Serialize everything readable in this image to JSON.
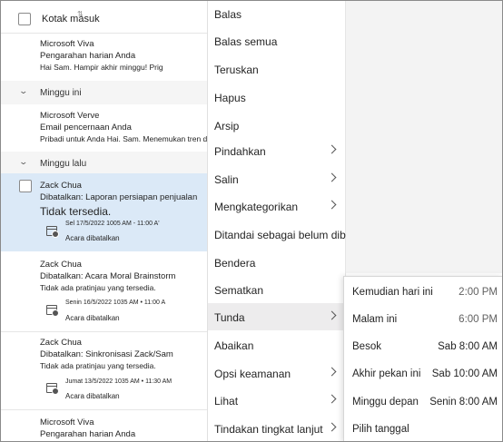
{
  "list_header": {
    "title": "Kotak masuk"
  },
  "groups": {
    "this_week": "Minggu ini",
    "last_week": "Minggu lalu"
  },
  "items": [
    {
      "sender": "Microsoft Viva",
      "subject": "Pengarahan harian Anda",
      "preview": "Hai Sam. Hampir akhir minggu! Prig"
    },
    {
      "sender": "Microsoft Verve",
      "subject": "Email pencernaan Anda",
      "preview": "Pribadi untuk Anda Hai. Sam. Menemukan tren di"
    },
    {
      "sender": "Zack Chua",
      "subject": "Dibatalkan: Laporan persiapan penjualan",
      "preview": "Tidak tersedia.",
      "meta": "Sel 17/5/2022 1005 AM - 11:00 A'",
      "status": "Acara dibatalkan"
    },
    {
      "sender": "Zack Chua",
      "subject": "Dibatalkan: Acara Moral Brainstorm",
      "preview": "Tidak ada pratinjau yang tersedia.",
      "meta": "Senin 16/5/2022 1035 AM • 11:00 A",
      "status": "Acara dibatalkan"
    },
    {
      "sender": "Zack Chua",
      "subject": "Dibatalkan: Sinkronisasi Zack/Sam",
      "preview": "Tidak ada pratinjau yang tersedia.",
      "meta": "Jumat 13/5/2022 1035 AM • 11:30 AM",
      "status": "Acara dibatalkan"
    },
    {
      "sender": "Microsoft Viva",
      "subject": "Pengarahan harian Anda"
    }
  ],
  "context_menu": [
    {
      "label": "Balas",
      "submenu": false
    },
    {
      "label": "Balas semua",
      "submenu": false
    },
    {
      "label": "Teruskan",
      "submenu": false
    },
    {
      "label": "Hapus",
      "submenu": false
    },
    {
      "label": "Arsip",
      "submenu": false
    },
    {
      "label": "Pindahkan",
      "submenu": true
    },
    {
      "label": "Salin",
      "submenu": true
    },
    {
      "label": "Mengkategorikan",
      "submenu": true
    },
    {
      "label": "Ditandai sebagai belum dibaca",
      "submenu": false
    },
    {
      "label": "Bendera",
      "submenu": false
    },
    {
      "label": "Sematkan",
      "submenu": false
    },
    {
      "label": "Tunda",
      "submenu": true,
      "active": true
    },
    {
      "label": "Abaikan",
      "submenu": false
    },
    {
      "label": "Opsi keamanan",
      "submenu": true
    },
    {
      "label": "Lihat",
      "submenu": true
    },
    {
      "label": "Tindakan tingkat lanjut",
      "submenu": true
    }
  ],
  "snooze_menu": [
    {
      "label": "Kemudian hari ini",
      "time": "2:00 PM"
    },
    {
      "label": "Malam ini",
      "time": "6:00 PM"
    },
    {
      "label": "Besok",
      "time": "Sab 8:00 AM"
    },
    {
      "label": "Akhir pekan ini",
      "time": "Sab 10:00 AM"
    },
    {
      "label": "Minggu depan",
      "time": "Senin 8:00 AM"
    },
    {
      "label": "Pilih tanggal",
      "time": ""
    }
  ]
}
